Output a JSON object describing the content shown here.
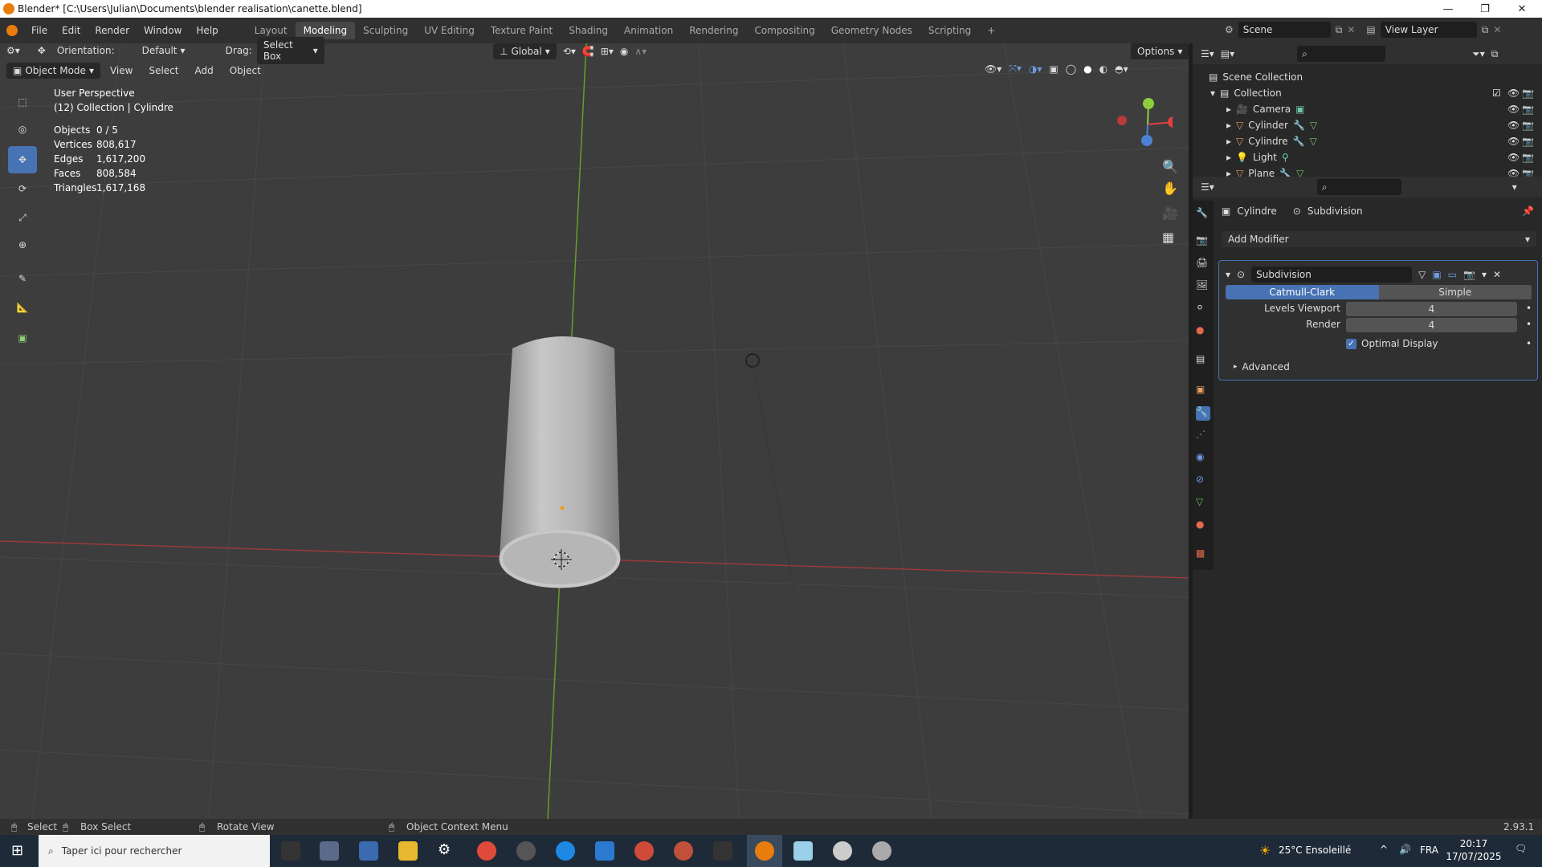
{
  "window": {
    "title": "Blender* [C:\\Users\\Julian\\Documents\\blender realisation\\canette.blend]"
  },
  "menu": [
    "File",
    "Edit",
    "Render",
    "Window",
    "Help"
  ],
  "workspaces": [
    "Layout",
    "Modeling",
    "Sculpting",
    "UV Editing",
    "Texture Paint",
    "Shading",
    "Animation",
    "Rendering",
    "Compositing",
    "Geometry Nodes",
    "Scripting"
  ],
  "active_workspace": "Modeling",
  "scene": {
    "name": "Scene",
    "view_layer": "View Layer"
  },
  "toolheader": {
    "orientation_label": "Orientation:",
    "orientation_value": "Default",
    "drag_label": "Drag:",
    "drag_value": "Select Box",
    "transform": "Global",
    "options": "Options"
  },
  "viewport_header": {
    "mode": "Object Mode",
    "view": "View",
    "select": "Select",
    "add": "Add",
    "object": "Object"
  },
  "overlay": {
    "perspective": "User Perspective",
    "collection": "(12) Collection | Cylindre",
    "stats": [
      {
        "label": "Objects",
        "value": "0 / 5"
      },
      {
        "label": "Vertices",
        "value": "808,617"
      },
      {
        "label": "Edges",
        "value": "1,617,200"
      },
      {
        "label": "Faces",
        "value": "808,584"
      },
      {
        "label": "Triangles",
        "value": "1,617,168"
      }
    ]
  },
  "outliner": {
    "root": "Scene Collection",
    "collection": "Collection",
    "items": [
      "Camera",
      "Cylinder",
      "Cylindre",
      "Light",
      "Plane"
    ]
  },
  "properties": {
    "object": "Cylindre",
    "modifier_crumb": "Subdivision",
    "add_modifier": "Add Modifier",
    "modifier_name": "Subdivision",
    "mode_a": "Catmull-Clark",
    "mode_b": "Simple",
    "levels_viewport_label": "Levels Viewport",
    "levels_viewport": "4",
    "render_label": "Render",
    "render": "4",
    "optimal_display": "Optimal Display",
    "advanced": "Advanced"
  },
  "status": {
    "select": "Select",
    "box_select": "Box Select",
    "rotate": "Rotate View",
    "context": "Object Context Menu",
    "version": "2.93.1"
  },
  "taskbar": {
    "search": "Taper ici pour rechercher",
    "weather": "25°C Ensoleillé",
    "lang": "FRA",
    "time": "20:17",
    "date": "17/07/2025"
  }
}
